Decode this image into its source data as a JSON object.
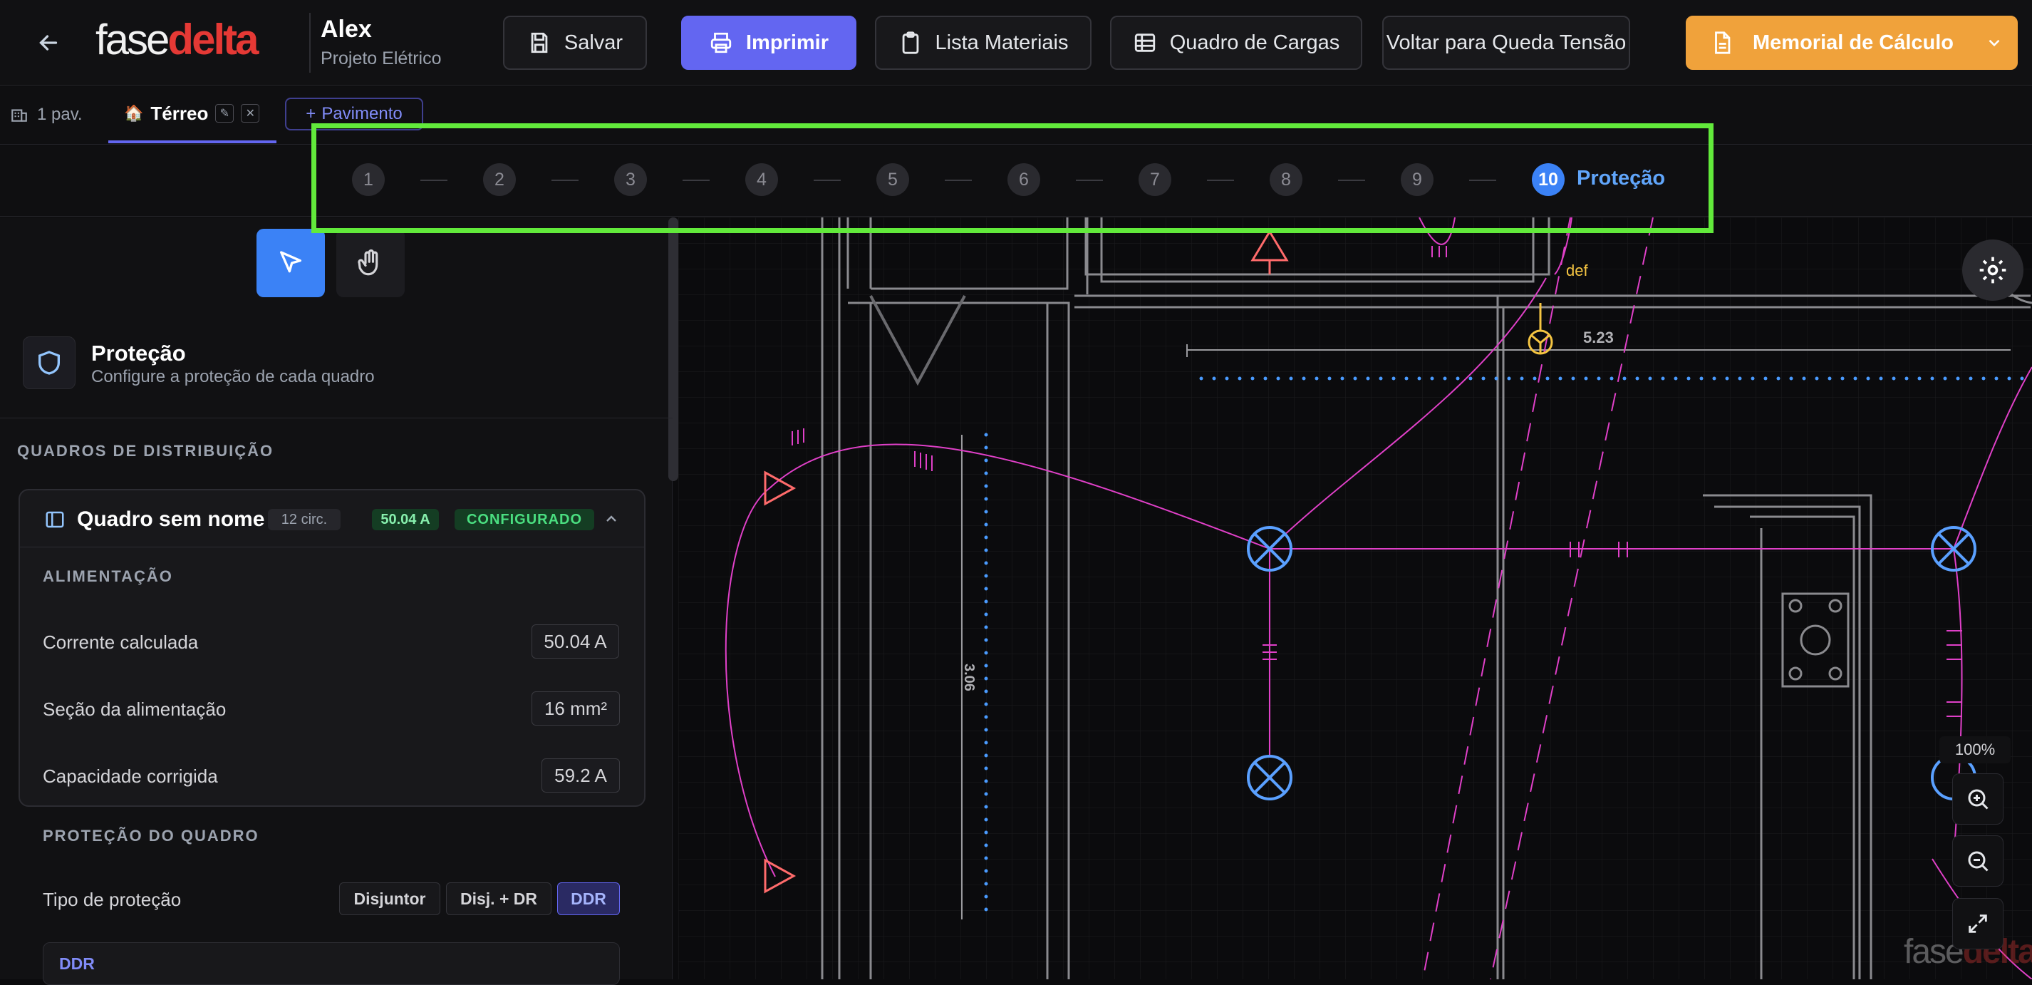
{
  "header": {
    "back_icon": "arrow-left-icon",
    "logo_part1": "fase",
    "logo_part2": "delta",
    "project_name": "Alex",
    "project_type": "Projeto Elétrico",
    "buttons": {
      "save": "Salvar",
      "print": "Imprimir",
      "materials": "Lista Materiais",
      "loads": "Quadro de Cargas",
      "voltage_drop": "Voltar para Queda Tensão",
      "memorial": "Memorial de Cálculo"
    }
  },
  "floors": {
    "count": "1 pav.",
    "active": "Térreo",
    "add": "Pavimento"
  },
  "steps": {
    "items": [
      "1",
      "2",
      "3",
      "4",
      "5",
      "6",
      "7",
      "8",
      "9",
      "10"
    ],
    "active_label": "Proteção"
  },
  "sidebar": {
    "title": "Proteção",
    "subtitle": "Configure a proteção de cada quadro",
    "section_label": "QUADROS DE DISTRIBUIÇÃO",
    "panel": {
      "name": "Quadro sem nome",
      "circuits": "12 circ.",
      "current_badge": "50.04 A",
      "status": "CONFIGURADO"
    },
    "feed_label": "ALIMENTAÇÃO",
    "rows": [
      {
        "label": "Corrente calculada",
        "value": "50.04 A"
      },
      {
        "label": "Seção da alimentação",
        "value": "16 mm²"
      },
      {
        "label": "Capacidade corrigida",
        "value": "59.2 A"
      }
    ],
    "protection_label": "PROTEÇÃO DO QUADRO",
    "protection_type_label": "Tipo de proteção",
    "protection_options": [
      "Disjuntor",
      "Disj. + DR",
      "DDR"
    ],
    "protection_selected": "DDR",
    "ddr_label": "DDR"
  },
  "canvas": {
    "dim_horizontal": "5.23",
    "dim_vertical": "3.06",
    "tag_def": "def",
    "zoom": "100%",
    "watermark_part1": "fase",
    "watermark_part2": "delta"
  },
  "colors": {
    "accent": "#6366f1",
    "step_active": "#3b82f6",
    "orange": "#f0a23b",
    "wire": "#e040c8",
    "fixture": "#5aa0ff",
    "outlet": "#ff6b6b",
    "highlight": "#62ea3b"
  }
}
